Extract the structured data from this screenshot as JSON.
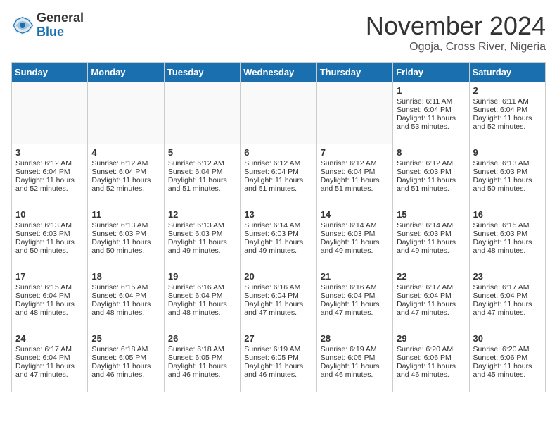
{
  "header": {
    "logo_general": "General",
    "logo_blue": "Blue",
    "month_title": "November 2024",
    "subtitle": "Ogoja, Cross River, Nigeria"
  },
  "calendar": {
    "days_of_week": [
      "Sunday",
      "Monday",
      "Tuesday",
      "Wednesday",
      "Thursday",
      "Friday",
      "Saturday"
    ],
    "weeks": [
      {
        "alt": false,
        "days": [
          {
            "num": "",
            "info": ""
          },
          {
            "num": "",
            "info": ""
          },
          {
            "num": "",
            "info": ""
          },
          {
            "num": "",
            "info": ""
          },
          {
            "num": "",
            "info": ""
          },
          {
            "num": "1",
            "info": "Sunrise: 6:11 AM\nSunset: 6:04 PM\nDaylight: 11 hours\nand 53 minutes."
          },
          {
            "num": "2",
            "info": "Sunrise: 6:11 AM\nSunset: 6:04 PM\nDaylight: 11 hours\nand 52 minutes."
          }
        ]
      },
      {
        "alt": true,
        "days": [
          {
            "num": "3",
            "info": "Sunrise: 6:12 AM\nSunset: 6:04 PM\nDaylight: 11 hours\nand 52 minutes."
          },
          {
            "num": "4",
            "info": "Sunrise: 6:12 AM\nSunset: 6:04 PM\nDaylight: 11 hours\nand 52 minutes."
          },
          {
            "num": "5",
            "info": "Sunrise: 6:12 AM\nSunset: 6:04 PM\nDaylight: 11 hours\nand 51 minutes."
          },
          {
            "num": "6",
            "info": "Sunrise: 6:12 AM\nSunset: 6:04 PM\nDaylight: 11 hours\nand 51 minutes."
          },
          {
            "num": "7",
            "info": "Sunrise: 6:12 AM\nSunset: 6:04 PM\nDaylight: 11 hours\nand 51 minutes."
          },
          {
            "num": "8",
            "info": "Sunrise: 6:12 AM\nSunset: 6:03 PM\nDaylight: 11 hours\nand 51 minutes."
          },
          {
            "num": "9",
            "info": "Sunrise: 6:13 AM\nSunset: 6:03 PM\nDaylight: 11 hours\nand 50 minutes."
          }
        ]
      },
      {
        "alt": false,
        "days": [
          {
            "num": "10",
            "info": "Sunrise: 6:13 AM\nSunset: 6:03 PM\nDaylight: 11 hours\nand 50 minutes."
          },
          {
            "num": "11",
            "info": "Sunrise: 6:13 AM\nSunset: 6:03 PM\nDaylight: 11 hours\nand 50 minutes."
          },
          {
            "num": "12",
            "info": "Sunrise: 6:13 AM\nSunset: 6:03 PM\nDaylight: 11 hours\nand 49 minutes."
          },
          {
            "num": "13",
            "info": "Sunrise: 6:14 AM\nSunset: 6:03 PM\nDaylight: 11 hours\nand 49 minutes."
          },
          {
            "num": "14",
            "info": "Sunrise: 6:14 AM\nSunset: 6:03 PM\nDaylight: 11 hours\nand 49 minutes."
          },
          {
            "num": "15",
            "info": "Sunrise: 6:14 AM\nSunset: 6:03 PM\nDaylight: 11 hours\nand 49 minutes."
          },
          {
            "num": "16",
            "info": "Sunrise: 6:15 AM\nSunset: 6:03 PM\nDaylight: 11 hours\nand 48 minutes."
          }
        ]
      },
      {
        "alt": true,
        "days": [
          {
            "num": "17",
            "info": "Sunrise: 6:15 AM\nSunset: 6:04 PM\nDaylight: 11 hours\nand 48 minutes."
          },
          {
            "num": "18",
            "info": "Sunrise: 6:15 AM\nSunset: 6:04 PM\nDaylight: 11 hours\nand 48 minutes."
          },
          {
            "num": "19",
            "info": "Sunrise: 6:16 AM\nSunset: 6:04 PM\nDaylight: 11 hours\nand 48 minutes."
          },
          {
            "num": "20",
            "info": "Sunrise: 6:16 AM\nSunset: 6:04 PM\nDaylight: 11 hours\nand 47 minutes."
          },
          {
            "num": "21",
            "info": "Sunrise: 6:16 AM\nSunset: 6:04 PM\nDaylight: 11 hours\nand 47 minutes."
          },
          {
            "num": "22",
            "info": "Sunrise: 6:17 AM\nSunset: 6:04 PM\nDaylight: 11 hours\nand 47 minutes."
          },
          {
            "num": "23",
            "info": "Sunrise: 6:17 AM\nSunset: 6:04 PM\nDaylight: 11 hours\nand 47 minutes."
          }
        ]
      },
      {
        "alt": false,
        "days": [
          {
            "num": "24",
            "info": "Sunrise: 6:17 AM\nSunset: 6:04 PM\nDaylight: 11 hours\nand 47 minutes."
          },
          {
            "num": "25",
            "info": "Sunrise: 6:18 AM\nSunset: 6:05 PM\nDaylight: 11 hours\nand 46 minutes."
          },
          {
            "num": "26",
            "info": "Sunrise: 6:18 AM\nSunset: 6:05 PM\nDaylight: 11 hours\nand 46 minutes."
          },
          {
            "num": "27",
            "info": "Sunrise: 6:19 AM\nSunset: 6:05 PM\nDaylight: 11 hours\nand 46 minutes."
          },
          {
            "num": "28",
            "info": "Sunrise: 6:19 AM\nSunset: 6:05 PM\nDaylight: 11 hours\nand 46 minutes."
          },
          {
            "num": "29",
            "info": "Sunrise: 6:20 AM\nSunset: 6:06 PM\nDaylight: 11 hours\nand 46 minutes."
          },
          {
            "num": "30",
            "info": "Sunrise: 6:20 AM\nSunset: 6:06 PM\nDaylight: 11 hours\nand 45 minutes."
          }
        ]
      }
    ]
  }
}
